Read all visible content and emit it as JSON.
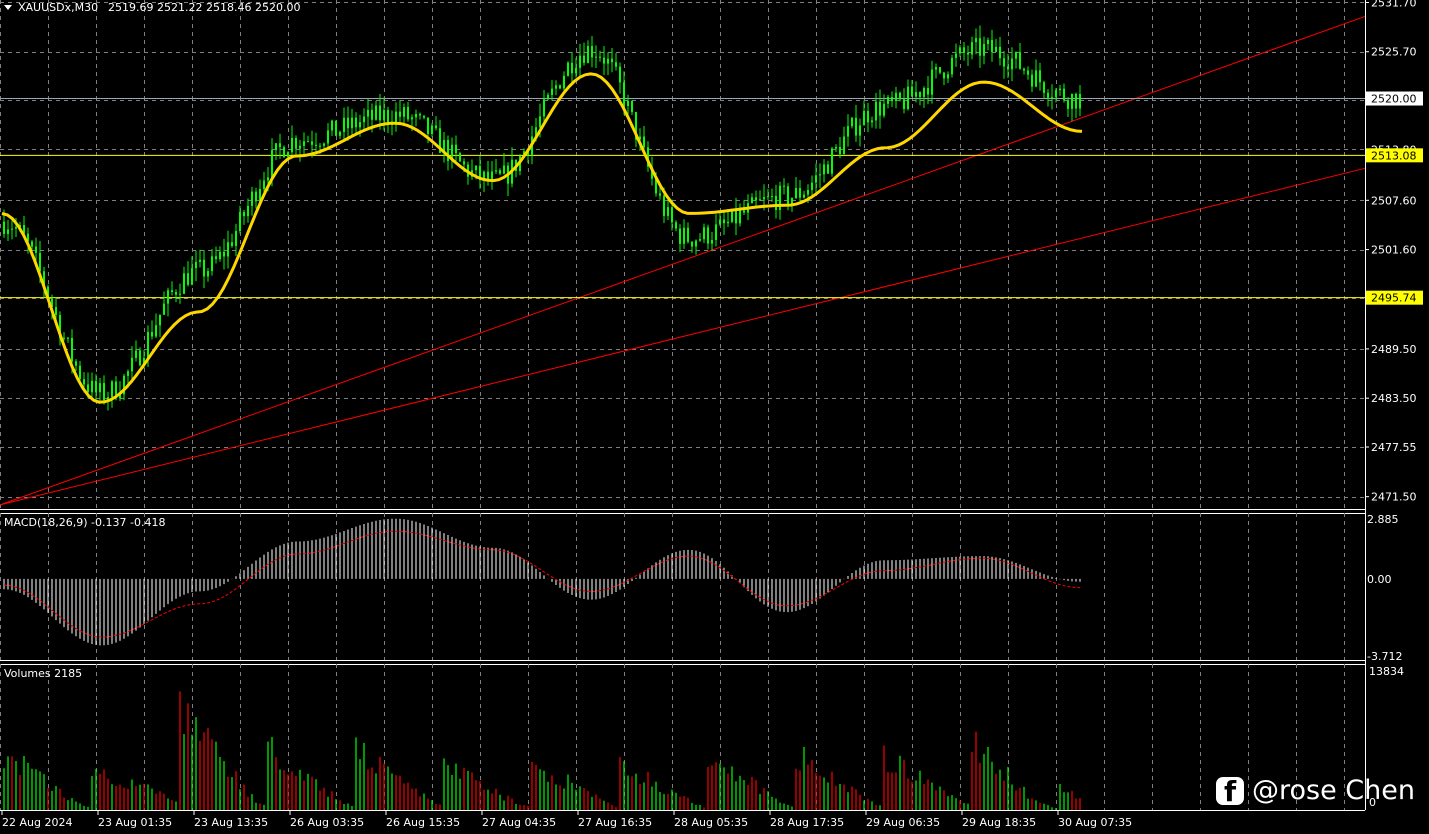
{
  "header": {
    "symbol": "XAUUSDx,M30",
    "ohlc": "2519.69 2521.22 2518.46 2520.00"
  },
  "price_axis": {
    "ticks": [
      "2531.70",
      "2525.70",
      "2519.80",
      "2513.80",
      "2507.60",
      "2501.60",
      "2495.70",
      "2489.50",
      "2483.50",
      "2477.55",
      "2471.50"
    ],
    "current_price_label": "2520.00",
    "levels": [
      {
        "label": "2513.08",
        "value": 2513.08,
        "color": "#ffff00"
      },
      {
        "label": "2495.74",
        "value": 2495.74,
        "color": "#ffff00"
      }
    ]
  },
  "macd": {
    "title": "MACD(18,26,9) -0.137 -0.418",
    "ticks": [
      "2.885",
      "0.00",
      "-3.712"
    ]
  },
  "volumes": {
    "title": "Volumes 2185",
    "ticks": [
      "13834",
      "0"
    ]
  },
  "time_axis": {
    "labels": [
      "22 Aug 2024",
      "23 Aug 01:35",
      "23 Aug 13:35",
      "26 Aug 03:35",
      "26 Aug 15:35",
      "27 Aug 04:35",
      "27 Aug 16:35",
      "28 Aug 05:35",
      "28 Aug 17:35",
      "29 Aug 06:35",
      "29 Aug 18:35",
      "30 Aug 07:35"
    ]
  },
  "watermark": "@rose Chen",
  "colors": {
    "bull": "#00ff00",
    "bear": "#ff0000",
    "ma": "#ffd700",
    "trend": "#ff0000",
    "grid": "#7f7f7f",
    "macd_hist": "#ffffff",
    "macd_signal": "#ff0000"
  },
  "chart_data": [
    {
      "type": "line",
      "title": "XAUUSDx,M30",
      "x": [
        "22 Aug 2024",
        "23 Aug 01:35",
        "23 Aug 13:35",
        "26 Aug 03:35",
        "26 Aug 15:35",
        "27 Aug 04:35",
        "27 Aug 16:35",
        "28 Aug 05:35",
        "28 Aug 17:35",
        "29 Aug 06:35",
        "29 Aug 18:35",
        "30 Aug 07:35"
      ],
      "ylim": [
        2470,
        2532
      ],
      "series": [
        {
          "name": "price",
          "values": [
            2505,
            2484,
            2499,
            2515,
            2518,
            2510,
            2526,
            2503,
            2508,
            2519,
            2526,
            2520
          ]
        },
        {
          "name": "ma",
          "values": [
            2506,
            2483,
            2494,
            2513,
            2517,
            2510,
            2523,
            2506,
            2507,
            2514,
            2522,
            2516
          ]
        }
      ],
      "grid": true
    },
    {
      "type": "bar",
      "title": "MACD(18,26,9) -0.137 -0.418",
      "ylim": [
        -3.712,
        2.885
      ],
      "series": [
        {
          "name": "macd",
          "values": [
            -0.5,
            -3.2,
            -0.6,
            1.8,
            2.9,
            1.5,
            -1.0,
            1.4,
            -1.6,
            0.9,
            1.1,
            -0.137
          ]
        },
        {
          "name": "signal",
          "values": [
            -0.3,
            -2.8,
            -1.2,
            1.2,
            2.3,
            1.4,
            -0.6,
            1.1,
            -1.3,
            0.4,
            1.0,
            -0.418
          ]
        }
      ]
    },
    {
      "type": "bar",
      "title": "Volumes 2185",
      "ylim": [
        0,
        13834
      ],
      "series": [
        {
          "name": "volume",
          "values": [
            7500,
            5200,
            12500,
            6800,
            8200,
            5200,
            6200,
            5500,
            7000,
            6800,
            8300,
            2185
          ]
        }
      ]
    }
  ]
}
